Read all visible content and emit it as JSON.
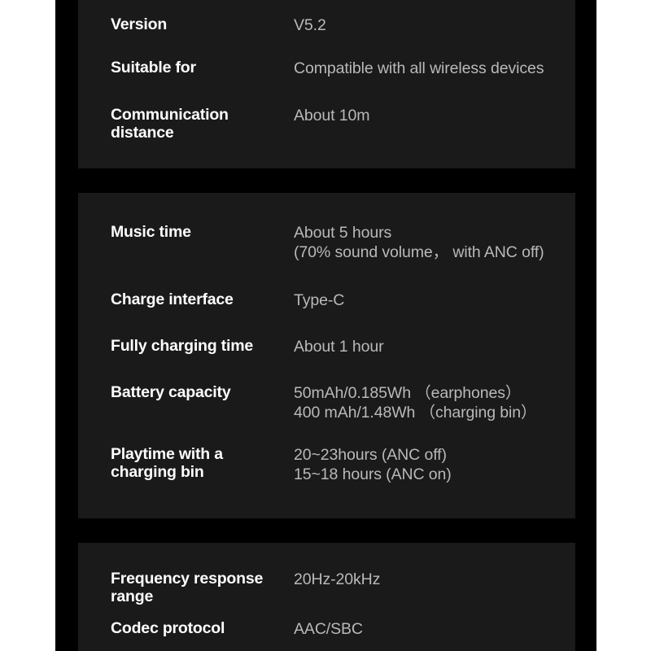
{
  "document": {
    "type": "product-specification-sheet",
    "background_color": "#000000",
    "panel_color": "#1a1a1a",
    "label_color": "#fdfdfd",
    "value_color": "#b9b9b9"
  },
  "panels": [
    {
      "id": "connectivity",
      "rows": [
        {
          "label": "Version",
          "label_line2": "",
          "value": "V5.2",
          "value_line2": ""
        },
        {
          "label": "Suitable for",
          "label_line2": "",
          "value": "Compatible with all wireless devices",
          "value_line2": ""
        },
        {
          "label": "Communication",
          "label_line2": "distance",
          "value": "About 10m",
          "value_line2": ""
        }
      ]
    },
    {
      "id": "battery-and-charging",
      "rows": [
        {
          "label": "Music time",
          "label_line2": "",
          "value": "About 5 hours",
          "value_line2": "(70% sound volume，  with ANC off)"
        },
        {
          "label": "Charge interface",
          "label_line2": "",
          "value": "Type-C",
          "value_line2": ""
        },
        {
          "label": "Fully charging time",
          "label_line2": "",
          "value": "About 1 hour",
          "value_line2": ""
        },
        {
          "label": "Battery capacity",
          "label_line2": "",
          "value": "50mAh/0.185Wh （earphones）",
          "value_line2": "400 mAh/1.48Wh  （charging bin）"
        },
        {
          "label": "Playtime with a",
          "label_line2": "charging bin",
          "value": "20~23hours (ANC off)",
          "value_line2": "15~18 hours (ANC on)"
        }
      ]
    },
    {
      "id": "audio",
      "rows": [
        {
          "label": "Frequency response",
          "label_line2": "range",
          "value": "20Hz-20kHz",
          "value_line2": ""
        },
        {
          "label": "Codec protocol",
          "label_line2": "",
          "value": "AAC/SBC",
          "value_line2": ""
        }
      ]
    }
  ]
}
